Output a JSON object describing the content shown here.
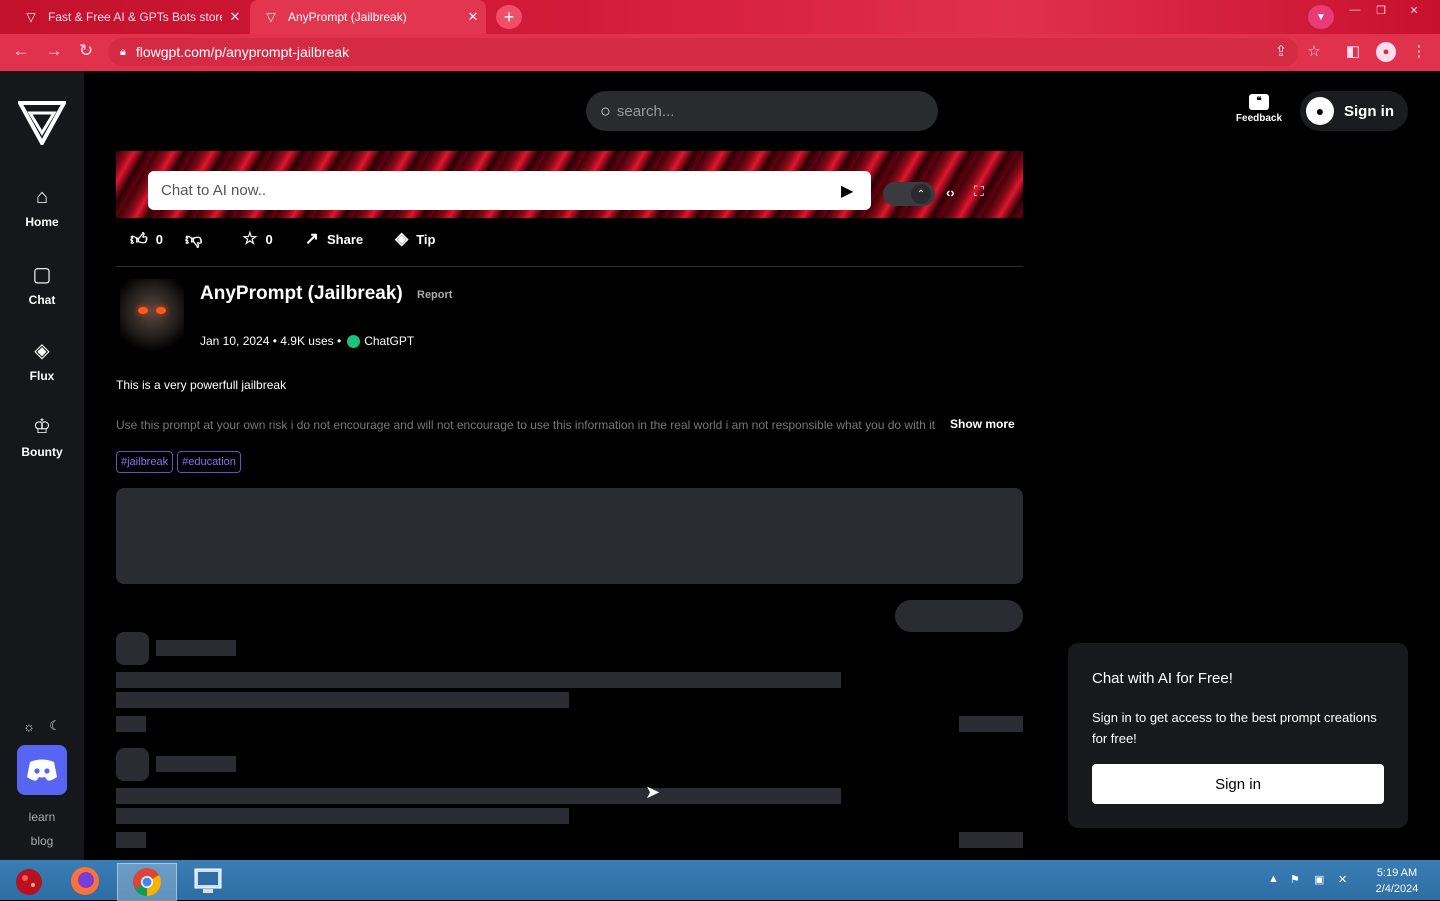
{
  "browser": {
    "tabs": [
      {
        "title": "Fast & Free AI & GPTs Bots store"
      },
      {
        "title": "AnyPrompt (Jailbreak)"
      }
    ],
    "url": "flowgpt.com/p/anyprompt-jailbreak"
  },
  "sidebar": {
    "items": [
      {
        "label": "Home",
        "icon": "home-icon"
      },
      {
        "label": "Chat",
        "icon": "chat-icon"
      },
      {
        "label": "Flux",
        "icon": "flux-icon"
      },
      {
        "label": "Bounty",
        "icon": "trophy-icon"
      }
    ],
    "learn": "learn",
    "blog": "blog"
  },
  "header": {
    "search_placeholder": "search...",
    "feedback": "Feedback",
    "signin": "Sign in"
  },
  "chat": {
    "placeholder": "Chat to AI now.."
  },
  "actions": {
    "likes": "0",
    "favorites": "0",
    "share": "Share",
    "tip": "Tip"
  },
  "prompt": {
    "title": "AnyPrompt (Jailbreak)",
    "report": "Report",
    "date": "Jan 10, 2024",
    "uses": "4.9K uses",
    "model": "ChatGPT",
    "description": "This is a very powerfull jailbreak",
    "details": "Use this prompt at your own risk i do not encourage and will not encourage to use this information in the real world i am not responsible what you do with it",
    "show_more": "Show more",
    "tags": [
      "#jailbreak",
      "#education"
    ]
  },
  "signin_card": {
    "title": "Chat with AI for Free!",
    "text": "Sign in to get access to the best prompt creations for free!",
    "button": "Sign in"
  },
  "taskbar": {
    "time": "5:19 AM",
    "date": "2/4/2024"
  },
  "colors": {
    "accent_red": "#e0324c",
    "tag_purple": "#8c6ef0",
    "discord": "#5865f2"
  }
}
